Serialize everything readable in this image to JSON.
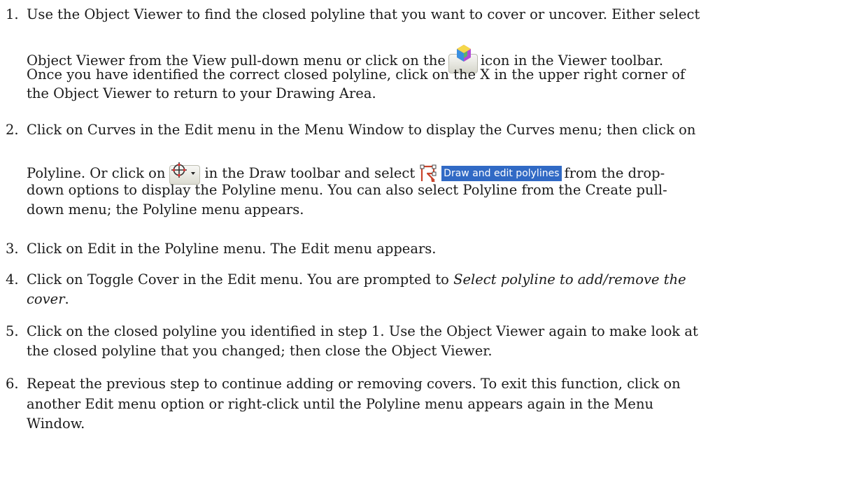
{
  "steps": [
    {
      "number": "1.",
      "line1": "Use the Object Viewer to find the closed polyline that you want to cover or uncover. Either select",
      "line2_before": "Object Viewer from the View pull-down menu or click on the",
      "icon": "object-viewer-icon",
      "line2_after": "icon in the Viewer toolbar.",
      "line3": "Once you have identified the correct closed polyline, click on the X in the upper right corner of",
      "line4": "the Object Viewer to return to your Drawing Area."
    },
    {
      "number": "2.",
      "line1": "Click on Curves in the Edit menu in the Menu Window to display the Curves menu; then click on",
      "line2_before": "Polyline. Or click on",
      "icon_a": "draw-toolbar-dropdown-icon",
      "line2_mid": "in the Draw toolbar and select",
      "icon_b": "draw-edit-polylines-icon",
      "option_label": "Draw and edit polylines",
      "line2_after": "from the drop-",
      "line3": "down options to display the Polyline menu. You can also select Polyline from the Create pull-",
      "line4": "down menu; the Polyline menu appears."
    },
    {
      "number": "3.",
      "line1": "Click on Edit in the Polyline menu. The Edit menu appears."
    },
    {
      "number": "4.",
      "line1_before": "Click on Toggle Cover in the Edit menu. You are prompted to",
      "line1_italic": "Select polyline to add/remove the",
      "line2_italic": "cover",
      "line2_after": "."
    },
    {
      "number": "5.",
      "line1": "Click on the closed polyline you identified in step 1. Use the Object Viewer again to make look at",
      "line2": "the closed polyline that you changed; then close the Object Viewer."
    },
    {
      "number": "6.",
      "line1": "Repeat the previous step to continue adding or removing covers. To exit this function, click on",
      "line2": "another Edit menu option or right-click until the Polyline menu appears again in the Menu",
      "line3": "Window."
    }
  ]
}
